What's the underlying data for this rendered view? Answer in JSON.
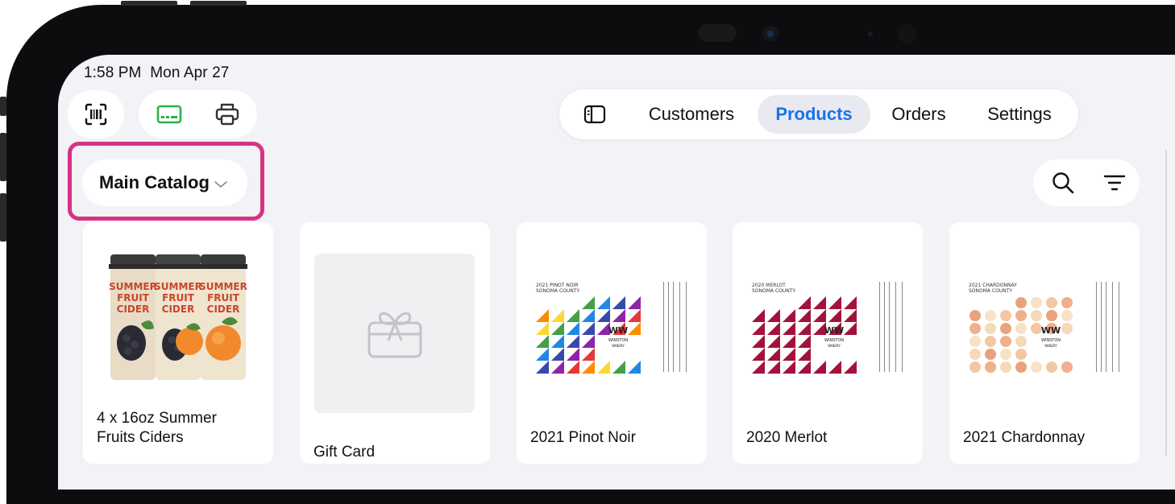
{
  "status": {
    "time": "1:58 PM",
    "date": "Mon Apr 27"
  },
  "toolbar": {
    "scan_icon": "barcode-scan-icon",
    "card_icon": "card-reader-icon",
    "print_icon": "printer-icon",
    "card_icon_color": "#2bb24c"
  },
  "nav": {
    "sidebar_icon": "sidebar-toggle-icon",
    "items": [
      {
        "label": "Customers"
      },
      {
        "label": "Products",
        "active": true
      },
      {
        "label": "Orders"
      },
      {
        "label": "Settings"
      }
    ],
    "active_color": "#1a73e8"
  },
  "catalog": {
    "label": "Main Catalog",
    "highlight_color": "#d63384"
  },
  "actions": {
    "search_icon": "search-icon",
    "filter_icon": "filter-icon"
  },
  "products": [
    {
      "title_line1": "4 x 16oz Summer",
      "title_line2": "Fruits Ciders",
      "image": "cider-cans",
      "can_text": [
        "SUMMER",
        "FRUIT",
        "CIDER"
      ]
    },
    {
      "title_line1": "Gift Card",
      "image": "gift-card-placeholder"
    },
    {
      "title_line1": "2021 Pinot Noir",
      "image": "wine-label",
      "label_heading": "2021 PINOT NOIR",
      "label_sub": "SONOMA COUNTY"
    },
    {
      "title_line1": "2020 Merlot",
      "image": "wine-label",
      "label_heading": "2020 MERLOT",
      "label_sub": "SONOMA COUNTY"
    },
    {
      "title_line1": "2021 Chardonnay",
      "image": "wine-label",
      "label_heading": "2021 CHARDONNAY",
      "label_sub": "SONOMA COUNTY"
    }
  ],
  "brand": {
    "name": "WINSTON",
    "sub": "WINERY",
    "mark": "WW"
  }
}
